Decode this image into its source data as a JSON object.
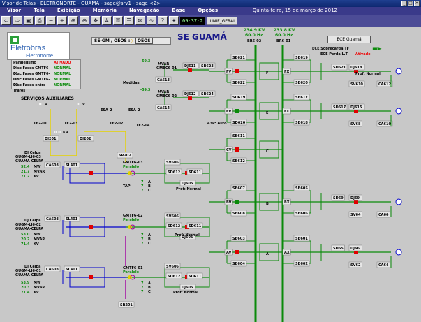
{
  "window": {
    "title": "Visor de Telas - ELETRONORTE - GUAMA - sage@srv1 - sage <2>"
  },
  "menu": [
    "Visor",
    "Tela",
    "Exibição",
    "Memória",
    "Navegação",
    "Base",
    "Opções"
  ],
  "menu_date": "Quinta-feira, 15 de março de 2012",
  "toolbar": {
    "clock": "09:37:2",
    "screen": "UNIF_GERAL"
  },
  "logo": {
    "name": "Eletrobras",
    "sub": "Eletronorte"
  },
  "mode": {
    "label": "SE-GM / OEOS :",
    "value": "OEOS"
  },
  "page_title": "SE GUAMÁ",
  "ece_button": "ECE Guamá",
  "ece_status": [
    {
      "label": "ECE Sobrecarga TF",
      "state": ""
    },
    {
      "label": "ECE Perda L.T",
      "state": "Ativado"
    }
  ],
  "alarms": [
    {
      "k": "Paralelismo",
      "v": "ATIVADO"
    },
    {
      "k": "Disc Fases GMTF6-01",
      "v": "NORMAL"
    },
    {
      "k": "Disc Fases GMTF6-02",
      "v": "NORMAL"
    },
    {
      "k": "Disc Fases GMTF6-03",
      "v": "NORMAL"
    },
    {
      "k": "Disc Fases entre Trafos",
      "v": "NORMAL"
    }
  ],
  "bus_readings": {
    "b02": {
      "kv": "234.9 KV",
      "hz": "60.0 Hz",
      "name": "BR6-02"
    },
    "b01": {
      "kv": "233.8 KV",
      "hz": "60.0 Hz",
      "name": "BR6-01"
    }
  },
  "aux": {
    "title": "SERVIÇOS AUXILIARES",
    "v1": "0",
    "v2": "0",
    "v3": "0.0",
    "unit": "V",
    "kv": "KV"
  },
  "transformers": [
    "TF2-01",
    "TF2-03",
    "TF2-02",
    "TF2-04",
    "ESA-2",
    "ESA-2"
  ],
  "meas": {
    "mvar1": "-59.3",
    "mvar2": "-59.3",
    "label": "MVAR",
    "g1": "GMBC6-01",
    "g2": "GMBC6-02",
    "medidas": "Medidas"
  },
  "lines": [
    {
      "title": "DJ Celpa",
      "name": "GUGM-LI6-03",
      "sub": "GUAMA-CELPA",
      "mw": "52.4",
      "mvar": "21.7",
      "kv": "71.2"
    },
    {
      "title": "DJ Celpa",
      "name": "GUGM-LI6-02",
      "sub": "GUAMA-CELPA",
      "mw": "53.0",
      "mvar": "20.2",
      "kv": "71.4"
    },
    {
      "title": "DJ Celpa",
      "name": "GUGM-LI6-01",
      "sub": "GUAMA-CELPA",
      "mw": "53.9",
      "mvar": "20.3",
      "kv": "71.4"
    }
  ],
  "tf": [
    {
      "name": "GMTF6-03",
      "state": "Paralelo",
      "tap": "7",
      "a": "7",
      "b": "7",
      "c": "7"
    },
    {
      "name": "GMTF6-02",
      "state": "Paralelo",
      "tap": "7",
      "a": "7",
      "b": "7",
      "c": "7"
    },
    {
      "name": "GMTF6-01",
      "state": "Paralelo",
      "tap": "7",
      "a": "7",
      "b": "7",
      "c": "7"
    }
  ],
  "bays": [
    "F",
    "E",
    "C",
    "B",
    "A"
  ],
  "prot": "Prof: Normal",
  "cc": "43P: Auto",
  "colors": {
    "green": "#0a8a0a",
    "red": "#e00000",
    "yellow": "#e6d200",
    "blue": "#0000cc",
    "purple": "#a000a0"
  }
}
